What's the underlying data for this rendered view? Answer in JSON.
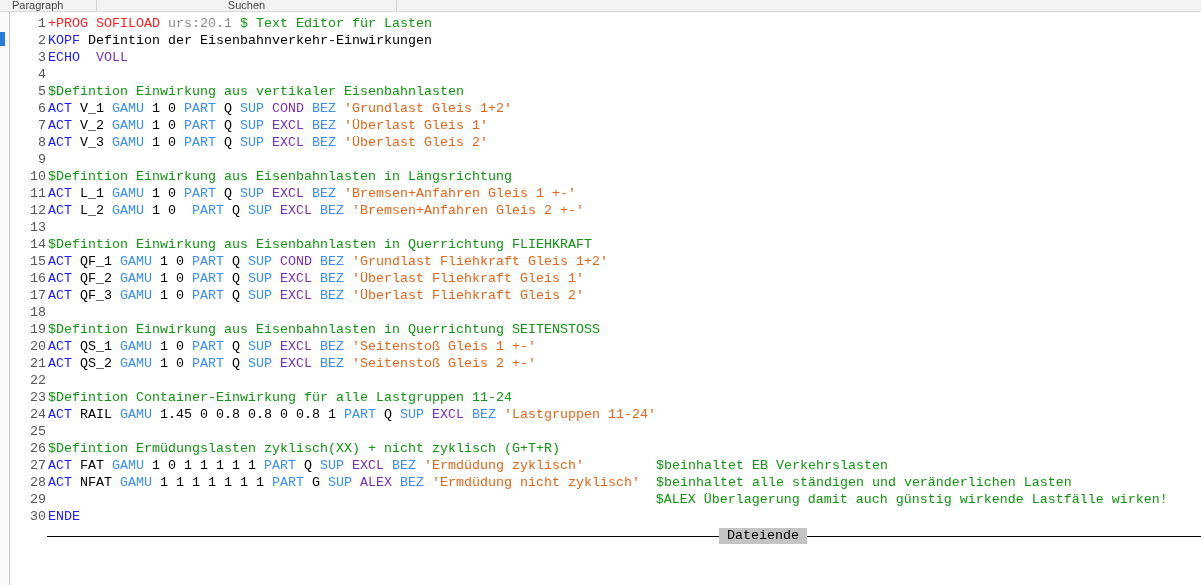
{
  "ribbon_groups": [
    {
      "label": "Paragraph"
    },
    {
      "label": "Suchen"
    }
  ],
  "editor": {
    "lines": [
      {
        "number": "1",
        "tokens": [
          {
            "kind": "prog",
            "text": "+PROG SOFILOAD"
          },
          {
            "kind": "ver",
            "text": " urs:20.1"
          },
          {
            "kind": "cmt",
            "text": " $ Text Editor für Lasten"
          }
        ]
      },
      {
        "number": "2",
        "tokens": [
          {
            "kind": "cmd",
            "text": "KOPF"
          },
          {
            "kind": "txt",
            "text": " Defintion der Eisenbahnverkehr-Einwirkungen"
          }
        ]
      },
      {
        "number": "3",
        "tokens": [
          {
            "kind": "cmd",
            "text": "ECHO"
          },
          {
            "kind": "opt",
            "text": "  VOLL"
          }
        ]
      },
      {
        "number": "4"
      },
      {
        "number": "5",
        "tokens": [
          {
            "kind": "cmt",
            "text": "$Defintion Einwirkung aus vertikaler Eisenbahnlasten"
          }
        ]
      },
      {
        "number": "6",
        "tokens": [
          {
            "kind": "cmd",
            "text": "ACT"
          },
          {
            "kind": "txt",
            "text": " V_1"
          },
          {
            "kind": "kw",
            "text": " GAMU"
          },
          {
            "kind": "txt",
            "text": " 1 0"
          },
          {
            "kind": "kw",
            "text": " PART"
          },
          {
            "kind": "txt",
            "text": " Q"
          },
          {
            "kind": "kw",
            "text": " SUP"
          },
          {
            "kind": "opt",
            "text": " COND"
          },
          {
            "kind": "kw",
            "text": " BEZ"
          },
          {
            "kind": "str",
            "text": " 'Grundlast Gleis 1+2'"
          }
        ]
      },
      {
        "number": "7",
        "tokens": [
          {
            "kind": "cmd",
            "text": "ACT"
          },
          {
            "kind": "txt",
            "text": " V_2"
          },
          {
            "kind": "kw",
            "text": " GAMU"
          },
          {
            "kind": "txt",
            "text": " 1 0"
          },
          {
            "kind": "kw",
            "text": " PART"
          },
          {
            "kind": "txt",
            "text": " Q"
          },
          {
            "kind": "kw",
            "text": " SUP"
          },
          {
            "kind": "opt",
            "text": " EXCL"
          },
          {
            "kind": "kw",
            "text": " BEZ"
          },
          {
            "kind": "str",
            "text": " 'Überlast Gleis 1'"
          }
        ]
      },
      {
        "number": "8",
        "tokens": [
          {
            "kind": "cmd",
            "text": "ACT"
          },
          {
            "kind": "txt",
            "text": " V_3"
          },
          {
            "kind": "kw",
            "text": " GAMU"
          },
          {
            "kind": "txt",
            "text": " 1 0"
          },
          {
            "kind": "kw",
            "text": " PART"
          },
          {
            "kind": "txt",
            "text": " Q"
          },
          {
            "kind": "kw",
            "text": " SUP"
          },
          {
            "kind": "opt",
            "text": " EXCL"
          },
          {
            "kind": "kw",
            "text": " BEZ"
          },
          {
            "kind": "str",
            "text": " 'Überlast Gleis 2'"
          }
        ]
      },
      {
        "number": "9"
      },
      {
        "number": "10",
        "tokens": [
          {
            "kind": "cmt",
            "text": "$Defintion Einwirkung aus Eisenbahnlasten in Längsrichtung"
          }
        ]
      },
      {
        "number": "11",
        "tokens": [
          {
            "kind": "cmd",
            "text": "ACT"
          },
          {
            "kind": "txt",
            "text": " L_1"
          },
          {
            "kind": "kw",
            "text": " GAMU"
          },
          {
            "kind": "txt",
            "text": " 1 0"
          },
          {
            "kind": "kw",
            "text": " PART"
          },
          {
            "kind": "txt",
            "text": " Q"
          },
          {
            "kind": "kw",
            "text": " SUP"
          },
          {
            "kind": "opt",
            "text": " EXCL"
          },
          {
            "kind": "kw",
            "text": " BEZ"
          },
          {
            "kind": "str",
            "text": " 'Bremsen+Anfahren Gleis 1 +-'"
          }
        ]
      },
      {
        "number": "12",
        "tokens": [
          {
            "kind": "cmd",
            "text": "ACT"
          },
          {
            "kind": "txt",
            "text": " L_2"
          },
          {
            "kind": "kw",
            "text": " GAMU"
          },
          {
            "kind": "txt",
            "text": " 1 0"
          },
          {
            "kind": "kw",
            "text": "  PART"
          },
          {
            "kind": "txt",
            "text": " Q"
          },
          {
            "kind": "kw",
            "text": " SUP"
          },
          {
            "kind": "opt",
            "text": " EXCL"
          },
          {
            "kind": "kw",
            "text": " BEZ"
          },
          {
            "kind": "str",
            "text": " 'Bremsen+Anfahren Gleis 2 +-'"
          }
        ]
      },
      {
        "number": "13"
      },
      {
        "number": "14",
        "tokens": [
          {
            "kind": "cmt",
            "text": "$Defintion Einwirkung aus Eisenbahnlasten in Querrichtung FLIEHKRAFT"
          }
        ]
      },
      {
        "number": "15",
        "tokens": [
          {
            "kind": "cmd",
            "text": "ACT"
          },
          {
            "kind": "txt",
            "text": " QF_1"
          },
          {
            "kind": "kw",
            "text": " GAMU"
          },
          {
            "kind": "txt",
            "text": " 1 0"
          },
          {
            "kind": "kw",
            "text": " PART"
          },
          {
            "kind": "txt",
            "text": " Q"
          },
          {
            "kind": "kw",
            "text": " SUP"
          },
          {
            "kind": "opt",
            "text": " COND"
          },
          {
            "kind": "kw",
            "text": " BEZ"
          },
          {
            "kind": "str",
            "text": " 'Grundlast Fliehkraft Gleis 1+2'"
          }
        ]
      },
      {
        "number": "16",
        "tokens": [
          {
            "kind": "cmd",
            "text": "ACT"
          },
          {
            "kind": "txt",
            "text": " QF_2"
          },
          {
            "kind": "kw",
            "text": " GAMU"
          },
          {
            "kind": "txt",
            "text": " 1 0"
          },
          {
            "kind": "kw",
            "text": " PART"
          },
          {
            "kind": "txt",
            "text": " Q"
          },
          {
            "kind": "kw",
            "text": " SUP"
          },
          {
            "kind": "opt",
            "text": " EXCL"
          },
          {
            "kind": "kw",
            "text": " BEZ"
          },
          {
            "kind": "str",
            "text": " 'Überlast Fliehkraft Gleis 1'"
          }
        ]
      },
      {
        "number": "17",
        "tokens": [
          {
            "kind": "cmd",
            "text": "ACT"
          },
          {
            "kind": "txt",
            "text": " QF_3"
          },
          {
            "kind": "kw",
            "text": " GAMU"
          },
          {
            "kind": "txt",
            "text": " 1 0"
          },
          {
            "kind": "kw",
            "text": " PART"
          },
          {
            "kind": "txt",
            "text": " Q"
          },
          {
            "kind": "kw",
            "text": " SUP"
          },
          {
            "kind": "opt",
            "text": " EXCL"
          },
          {
            "kind": "kw",
            "text": " BEZ"
          },
          {
            "kind": "str",
            "text": " 'Überlast Fliehkraft Gleis 2'"
          }
        ]
      },
      {
        "number": "18"
      },
      {
        "number": "19",
        "tokens": [
          {
            "kind": "cmt",
            "text": "$Defintion Einwirkung aus Eisenbahnlasten in Querrichtung SEITENSTOSS"
          }
        ]
      },
      {
        "number": "20",
        "tokens": [
          {
            "kind": "cmd",
            "text": "ACT"
          },
          {
            "kind": "txt",
            "text": " QS_1"
          },
          {
            "kind": "kw",
            "text": " GAMU"
          },
          {
            "kind": "txt",
            "text": " 1 0"
          },
          {
            "kind": "kw",
            "text": " PART"
          },
          {
            "kind": "txt",
            "text": " Q"
          },
          {
            "kind": "kw",
            "text": " SUP"
          },
          {
            "kind": "opt",
            "text": " EXCL"
          },
          {
            "kind": "kw",
            "text": " BEZ"
          },
          {
            "kind": "str",
            "text": " 'Seitenstoß Gleis 1 +-'"
          }
        ]
      },
      {
        "number": "21",
        "tokens": [
          {
            "kind": "cmd",
            "text": "ACT"
          },
          {
            "kind": "txt",
            "text": " QS_2"
          },
          {
            "kind": "kw",
            "text": " GAMU"
          },
          {
            "kind": "txt",
            "text": " 1 0"
          },
          {
            "kind": "kw",
            "text": " PART"
          },
          {
            "kind": "txt",
            "text": " Q"
          },
          {
            "kind": "kw",
            "text": " SUP"
          },
          {
            "kind": "opt",
            "text": " EXCL"
          },
          {
            "kind": "kw",
            "text": " BEZ"
          },
          {
            "kind": "str",
            "text": " 'Seitenstoß Gleis 2 +-'"
          }
        ]
      },
      {
        "number": "22"
      },
      {
        "number": "23",
        "tokens": [
          {
            "kind": "cmt",
            "text": "$Defintion Container-Einwirkung für alle Lastgruppen 11-24"
          }
        ]
      },
      {
        "number": "24",
        "tokens": [
          {
            "kind": "cmd",
            "text": "ACT"
          },
          {
            "kind": "txt",
            "text": " RAIL"
          },
          {
            "kind": "kw",
            "text": " GAMU"
          },
          {
            "kind": "txt",
            "text": " 1.45 0 0.8 0.8 0 0.8 1"
          },
          {
            "kind": "kw",
            "text": " PART"
          },
          {
            "kind": "txt",
            "text": " Q"
          },
          {
            "kind": "kw",
            "text": " SUP"
          },
          {
            "kind": "opt",
            "text": " EXCL"
          },
          {
            "kind": "kw",
            "text": " BEZ"
          },
          {
            "kind": "str",
            "text": " 'Lastgruppen 11-24'"
          }
        ]
      },
      {
        "number": "25"
      },
      {
        "number": "26",
        "tokens": [
          {
            "kind": "cmt",
            "text": "$Defintion Ermüdungslasten zyklisch(XX) + nicht zyklisch (G+T+R)"
          }
        ]
      },
      {
        "number": "27",
        "tokens": [
          {
            "kind": "cmd",
            "text": "ACT"
          },
          {
            "kind": "txt",
            "text": " FAT"
          },
          {
            "kind": "kw",
            "text": " GAMU"
          },
          {
            "kind": "txt",
            "text": " 1 0 1 1 1 1 1"
          },
          {
            "kind": "kw",
            "text": " PART"
          },
          {
            "kind": "txt",
            "text": " Q"
          },
          {
            "kind": "kw",
            "text": " SUP"
          },
          {
            "kind": "opt",
            "text": " EXCL"
          },
          {
            "kind": "kw",
            "text": " BEZ"
          },
          {
            "kind": "str",
            "text": " 'Ermdüdung zyklisch'"
          },
          {
            "kind": "cmt",
            "text": "         $beinhaltet EB Verkehrslasten"
          }
        ]
      },
      {
        "number": "28",
        "tokens": [
          {
            "kind": "cmd",
            "text": "ACT"
          },
          {
            "kind": "txt",
            "text": " NFAT"
          },
          {
            "kind": "kw",
            "text": " GAMU"
          },
          {
            "kind": "txt",
            "text": " 1 1 1 1 1 1 1"
          },
          {
            "kind": "kw",
            "text": " PART"
          },
          {
            "kind": "txt",
            "text": " G"
          },
          {
            "kind": "kw",
            "text": " SUP"
          },
          {
            "kind": "opt",
            "text": " ALEX"
          },
          {
            "kind": "kw",
            "text": " BEZ"
          },
          {
            "kind": "str",
            "text": " 'Ermdüdung nicht zyklisch'"
          },
          {
            "kind": "cmt",
            "text": "  $beinhaltet alle ständigen und veränderlichen Lasten"
          }
        ]
      },
      {
        "number": "29",
        "tokens": [
          {
            "kind": "cmt",
            "text": "                                                                            $ALEX Überlagerung damit auch günstig wirkende Lastfälle wirken!"
          }
        ]
      },
      {
        "number": "30",
        "tokens": [
          {
            "kind": "cmd",
            "text": "ENDE"
          }
        ]
      }
    ],
    "end_marker": "Dateiende"
  }
}
